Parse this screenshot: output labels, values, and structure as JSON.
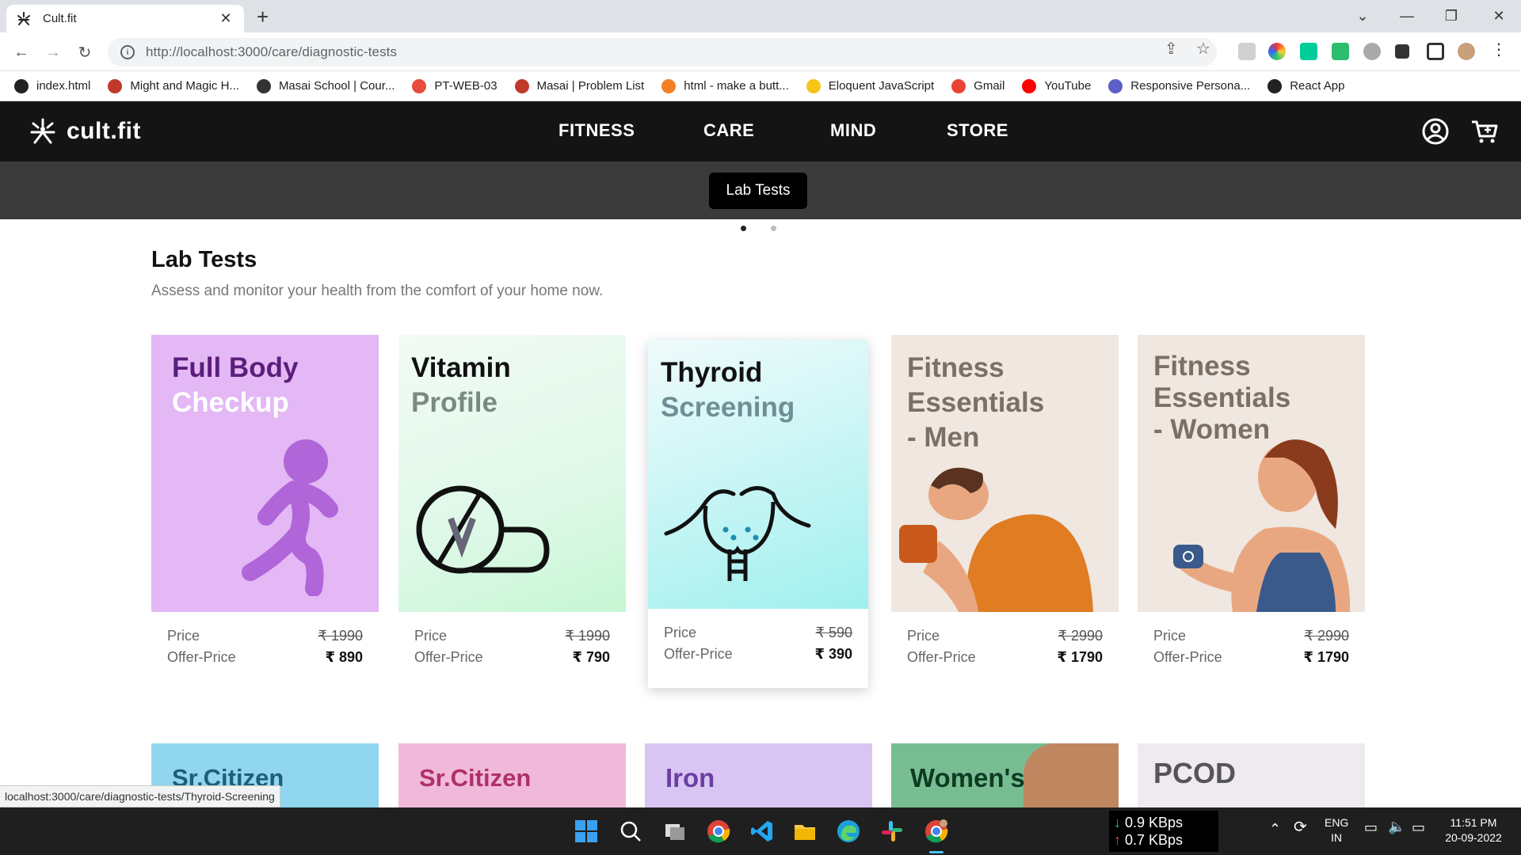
{
  "browser": {
    "tab_title": "Cult.fit",
    "url": "http://localhost:3000/care/diagnostic-tests",
    "bookmarks": [
      {
        "label": "index.html",
        "color": "#222"
      },
      {
        "label": "Might and Magic H...",
        "color": "#c0392b"
      },
      {
        "label": "Masai School | Cour...",
        "color": "#333"
      },
      {
        "label": "PT-WEB-03",
        "color": "#e74c3c"
      },
      {
        "label": "Masai | Problem List",
        "color": "#c0392b"
      },
      {
        "label": "html - make a butt...",
        "color": "#f48024"
      },
      {
        "label": "Eloquent JavaScript",
        "color": "#f5c518"
      },
      {
        "label": "Gmail",
        "color": "#ea4335"
      },
      {
        "label": "YouTube",
        "color": "#ff0000"
      },
      {
        "label": "Responsive Persona...",
        "color": "#5b5fc7"
      },
      {
        "label": "React App",
        "color": "#222"
      }
    ],
    "status_url": "localhost:3000/care/diagnostic-tests/Thyroid-Screening"
  },
  "site": {
    "logo_text": "cult.fit",
    "nav": [
      "FITNESS",
      "CARE",
      "MIND",
      "STORE"
    ],
    "subnav_active": "Lab Tests"
  },
  "section": {
    "title": "Lab Tests",
    "subtitle": "Assess and monitor your health from the comfort of your home now."
  },
  "labels": {
    "price": "Price",
    "offer_price": "Offer-Price"
  },
  "tests": [
    {
      "title_l1": "Full Body",
      "title_l2": "Checkup",
      "price": "₹ 1990",
      "offer": "₹ 890",
      "bg": "#e3b8f5",
      "c1": "#5b1e7a",
      "c2": "#ffffff"
    },
    {
      "title_l1": "Vitamin",
      "title_l2": "Profile",
      "price": "₹ 1990",
      "offer": "₹ 790",
      "bg": "#dff8e8",
      "c1": "#111111",
      "c2": "#7a8a80"
    },
    {
      "title_l1": "Thyroid",
      "title_l2": "Screening",
      "price": "₹ 590",
      "offer": "₹ 390",
      "bg": "#c9f5f5",
      "c1": "#111111",
      "c2": "#6f8f96"
    },
    {
      "title_l1": "Fitness",
      "title_l2": "Essentials",
      "title_l3": "- Men",
      "price": "₹ 2990",
      "offer": "₹ 1790",
      "bg": "#efe7e0",
      "c1": "#7a7068",
      "c2": "#7a7068"
    },
    {
      "title_l1": "Fitness",
      "title_l2": "Essentials",
      "title_l3": "- Women",
      "price": "₹ 2990",
      "offer": "₹ 1790",
      "bg": "#efe7e0",
      "c1": "#7a7068",
      "c2": "#7a7068"
    }
  ],
  "tests_row2": [
    {
      "title": "Sr.Citizen",
      "bg": "#8fd6ee",
      "color": "#1e5e7a"
    },
    {
      "title": "Sr.Citizen",
      "bg": "#f1b9d9",
      "color": "#b0306a"
    },
    {
      "title": "Iron",
      "bg": "#d9c5f3",
      "color": "#6a3fa0"
    },
    {
      "title": "Women's",
      "bg": "#78bd92",
      "color": "#0d3b22"
    },
    {
      "title": "PCOD",
      "bg": "#eeeaf0",
      "color": "#555555"
    }
  ],
  "taskbar": {
    "net_down": "0.9 KBps",
    "net_up": "0.7 KBps",
    "lang1": "ENG",
    "lang2": "IN",
    "time": "11:51 PM",
    "date": "20-09-2022"
  }
}
